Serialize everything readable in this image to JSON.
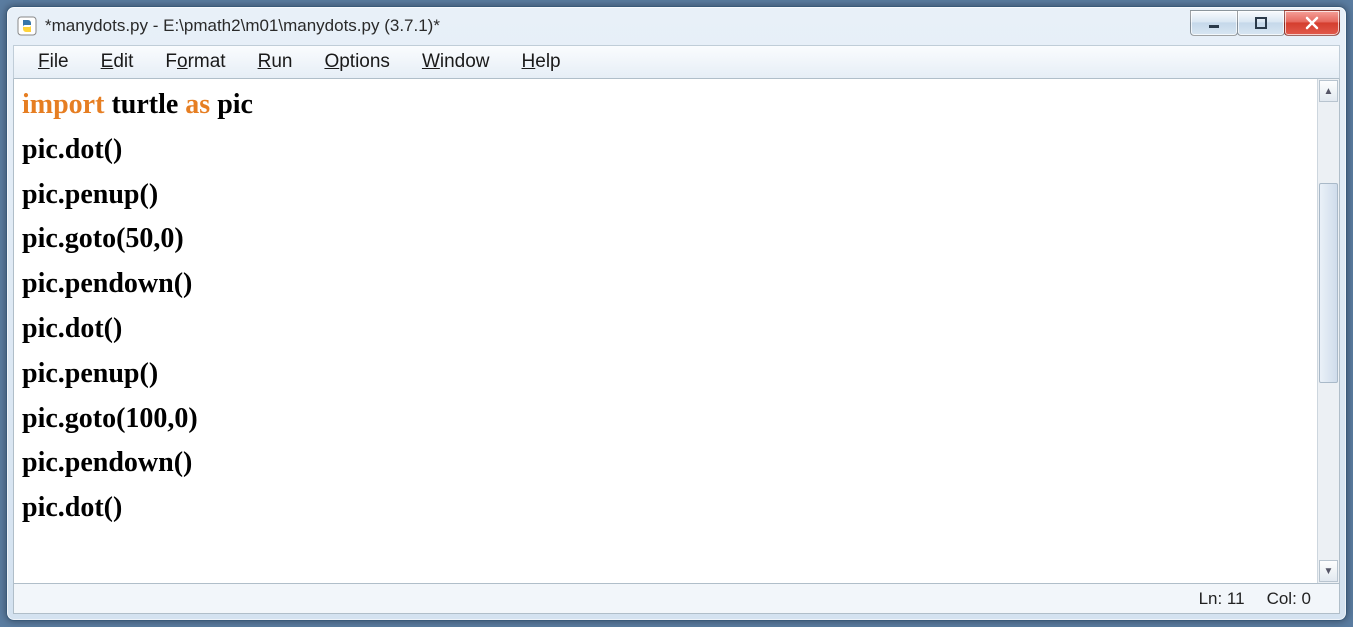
{
  "window": {
    "title": "*manydots.py - E:\\pmath2\\m01\\manydots.py (3.7.1)*"
  },
  "menubar": {
    "items": [
      {
        "label": "File",
        "accel": "F"
      },
      {
        "label": "Edit",
        "accel": "E"
      },
      {
        "label": "Format",
        "accel": "o"
      },
      {
        "label": "Run",
        "accel": "R"
      },
      {
        "label": "Options",
        "accel": "O"
      },
      {
        "label": "Window",
        "accel": "W"
      },
      {
        "label": "Help",
        "accel": "H"
      }
    ]
  },
  "editor": {
    "lines": [
      {
        "tokens": [
          {
            "t": "import ",
            "c": "kw-orange"
          },
          {
            "t": "turtle ",
            "c": ""
          },
          {
            "t": "as ",
            "c": "kw-orange"
          },
          {
            "t": "pic",
            "c": ""
          }
        ]
      },
      {
        "tokens": [
          {
            "t": "pic.dot()",
            "c": ""
          }
        ]
      },
      {
        "tokens": [
          {
            "t": "pic.penup()",
            "c": ""
          }
        ]
      },
      {
        "tokens": [
          {
            "t": "pic.goto(50,0)",
            "c": ""
          }
        ]
      },
      {
        "tokens": [
          {
            "t": "pic.pendown()",
            "c": ""
          }
        ]
      },
      {
        "tokens": [
          {
            "t": "pic.dot()",
            "c": ""
          }
        ]
      },
      {
        "tokens": [
          {
            "t": "pic.penup()",
            "c": ""
          }
        ]
      },
      {
        "tokens": [
          {
            "t": "pic.goto(100,0)",
            "c": ""
          }
        ]
      },
      {
        "tokens": [
          {
            "t": "pic.pendown()",
            "c": ""
          }
        ]
      },
      {
        "tokens": [
          {
            "t": "pic.dot()",
            "c": ""
          }
        ]
      }
    ]
  },
  "statusbar": {
    "ln_label": "Ln: 11",
    "col_label": "Col: 0"
  },
  "icons": {
    "minimize": "minimize-icon",
    "maximize": "maximize-icon",
    "close": "close-icon",
    "scroll_up": "▲",
    "scroll_down": "▼"
  }
}
